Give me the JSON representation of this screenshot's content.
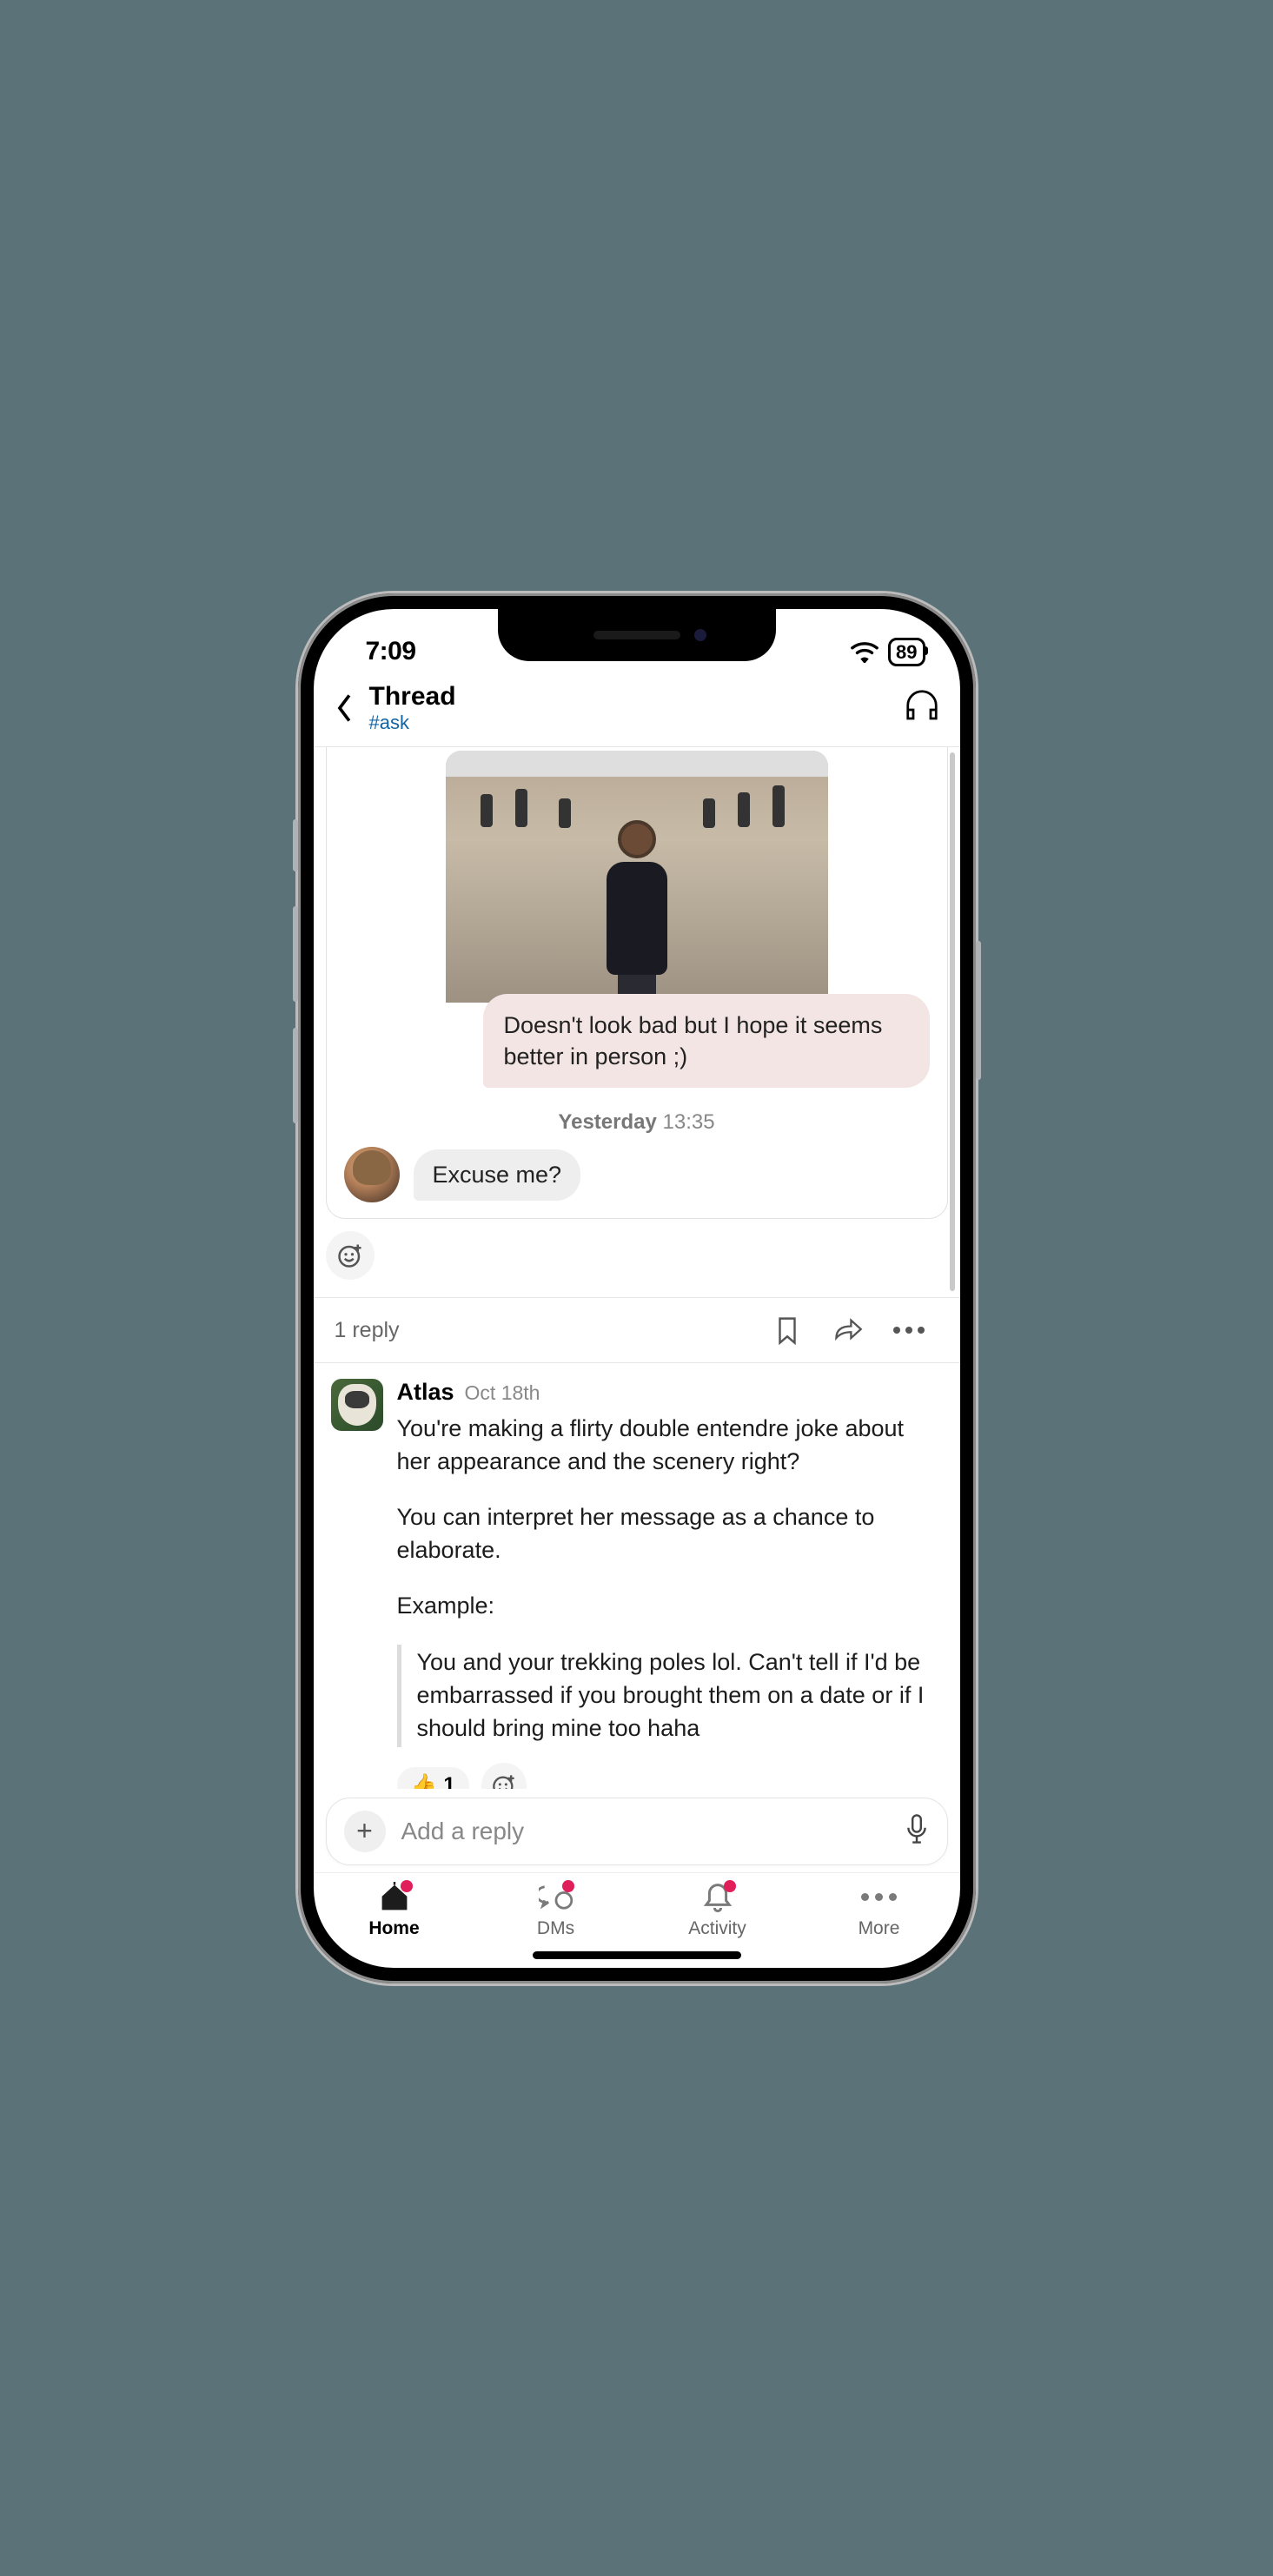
{
  "status": {
    "time": "7:09",
    "battery": "89"
  },
  "header": {
    "title": "Thread",
    "channel": "#ask"
  },
  "chat": {
    "pink_bubble": "Doesn't look bad but I hope it seems better in person ;)",
    "timestamp_label": "Yesterday",
    "timestamp_time": "13:35",
    "reply_bubble": "Excuse me?"
  },
  "thread": {
    "reply_count_label": "1 reply",
    "message": {
      "author": "Atlas",
      "time": "Oct 18th",
      "para1": "You're making a flirty double entendre joke about her appearance and the scenery right?",
      "para2": "You can interpret her message as a chance to elaborate.",
      "para3": "Example:",
      "quote": "You and your trekking poles lol. Can't tell if I'd be embarrassed if you brought them on a date or if I should bring mine too haha",
      "reaction_emoji": "👍",
      "reaction_count": "1"
    }
  },
  "composer": {
    "placeholder": "Add a reply"
  },
  "tabs": {
    "home": "Home",
    "dms": "DMs",
    "activity": "Activity",
    "more": "More"
  }
}
